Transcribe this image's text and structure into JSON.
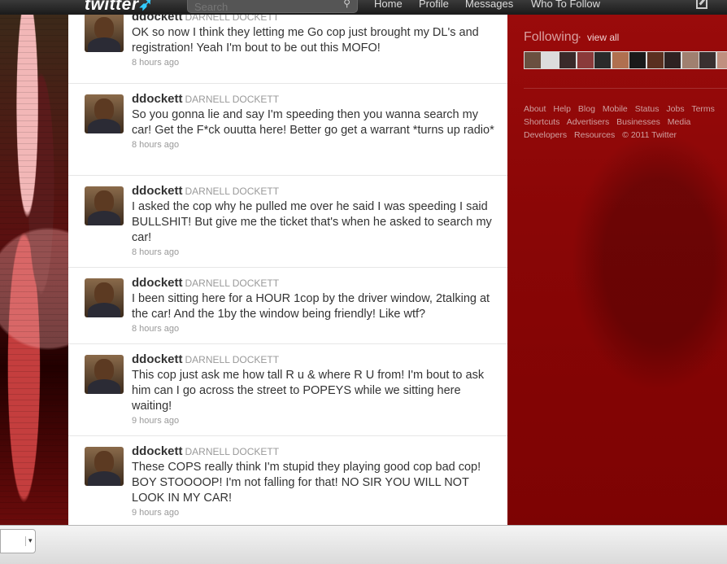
{
  "topbar": {
    "logo": "twitter",
    "search_placeholder": "Search",
    "nav": [
      "Home",
      "Profile",
      "Messages",
      "Who To Follow"
    ]
  },
  "tweets": [
    {
      "handle": "ddockett",
      "fullname": "DARNELL DOCKETT",
      "text": "OK so now I think they letting me Go cop just brought my DL's and registration! Yeah I'm bout to be out this MOFO!",
      "time": "8 hours ago"
    },
    {
      "handle": "ddockett",
      "fullname": "DARNELL DOCKETT",
      "text": "So you gonna lie and say I'm speeding then you wanna search my car! Get the F*ck ouutta here! Better go get a warrant *turns up radio*",
      "time": "8 hours ago"
    },
    {
      "handle": "ddockett",
      "fullname": "DARNELL DOCKETT",
      "text": "I asked the cop why he pulled me over he said I was speeding I said BULLSHIT! But give me the ticket that's when he asked to search my car!",
      "time": "8 hours ago"
    },
    {
      "handle": "ddockett",
      "fullname": "DARNELL DOCKETT",
      "text": "I been sitting here for a HOUR 1cop by the driver window, 2talking at the car! And the 1by the window being friendly! Like wtf?",
      "time": "8 hours ago"
    },
    {
      "handle": "ddockett",
      "fullname": "DARNELL DOCKETT",
      "text": "This cop just ask me how tall R u & where R U from! I'm bout to ask him can I go across the street to POPEYS while we sitting here waiting!",
      "time": "9 hours ago"
    },
    {
      "handle": "ddockett",
      "fullname": "DARNELL DOCKETT",
      "text": "These COPS really think I'm stupid they playing good cop bad cop! BOY STOOOOP! I'm not falling for that! NO SIR YOU WILL NOT LOOK IN MY CAR!",
      "time": "9 hours ago"
    }
  ],
  "sidebar": {
    "following_title": "Following",
    "view_all": "view all",
    "following_avatar_colors": [
      "#6a5040",
      "#dcdcdc",
      "#3a2a2a",
      "#8a3a3a",
      "#2a2a2a",
      "#b07050",
      "#1a1a1a",
      "#5a3020",
      "#2e2222",
      "#a08070",
      "#3a3030",
      "#c09080"
    ],
    "footer_links": [
      "About",
      "Help",
      "Blog",
      "Mobile",
      "Status",
      "Jobs",
      "Terms",
      "Shortcuts",
      "Advertisers",
      "Businesses",
      "Media",
      "Developers",
      "Resources",
      "© 2011 Twitter"
    ]
  },
  "colors": {
    "accent": "#33ccff",
    "sidebar_bg": "#8a0606"
  }
}
